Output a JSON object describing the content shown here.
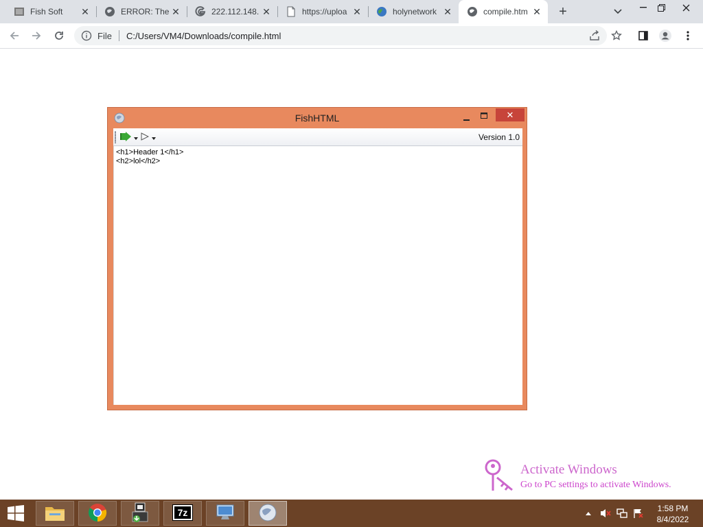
{
  "browser": {
    "tabs": [
      {
        "title": "Fish Soft",
        "icon": "fish-soft-favicon-icon",
        "active": false
      },
      {
        "title": "ERROR: The",
        "icon": "globe-icon",
        "active": false
      },
      {
        "title": "222.112.148.",
        "icon": "google-g-icon",
        "active": false
      },
      {
        "title": "https://uploa",
        "icon": "page-icon",
        "active": false
      },
      {
        "title": "holynetwork",
        "icon": "globe-color-icon",
        "active": false
      },
      {
        "title": "compile.htm",
        "icon": "globe-icon",
        "active": true
      }
    ],
    "address": {
      "scheme_label": "File",
      "url": "C:/Users/VM4/Downloads/compile.html"
    }
  },
  "app": {
    "title": "FishHTML",
    "version": "Version 1.0",
    "editor_lines": [
      "<h1>Header 1</h1>",
      "<h2>lol</h2>"
    ]
  },
  "watermark": {
    "line1": "Activate Windows",
    "line2": "Go to PC settings to activate Windows."
  },
  "taskbar": {
    "apps": [
      "file-explorer-icon",
      "chrome-icon",
      "installer-icon",
      "7zip-icon",
      "remote-desktop-icon",
      "globe-app-icon"
    ],
    "time": "1:58 PM",
    "date": "8/4/2022"
  },
  "colors": {
    "app_frame": "#e8895e",
    "close_button": "#c7443a",
    "taskbar": "#6b4226",
    "watermark": "#cc66cc"
  }
}
